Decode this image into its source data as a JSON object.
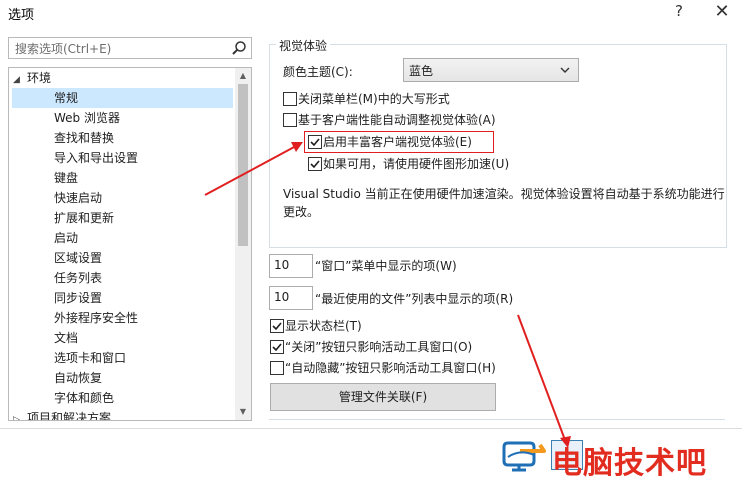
{
  "window": {
    "title": "选项",
    "help_glyph": "?",
    "close_glyph": "✕"
  },
  "search": {
    "placeholder": "搜索选项(Ctrl+E)"
  },
  "tree": {
    "parent_label": "环境",
    "items": [
      "常规",
      "Web 浏览器",
      "查找和替换",
      "导入和导出设置",
      "键盘",
      "快速启动",
      "扩展和更新",
      "启动",
      "区域设置",
      "任务列表",
      "同步设置",
      "外接程序安全性",
      "文档",
      "选项卡和窗口",
      "自动恢复",
      "字体和颜色"
    ],
    "next_root_label": "项目和解决方案",
    "selected_index": 0
  },
  "visual": {
    "group_title": "视觉体验",
    "theme_label": "颜色主题(C):",
    "theme_value": "蓝色",
    "options": [
      {
        "label": "关闭菜单栏(M)中的大写形式",
        "checked": false
      },
      {
        "label": "基于客户端性能自动调整视觉体验(A)",
        "checked": false
      },
      {
        "label": "启用丰富客户端视觉体验(E)",
        "checked": true
      },
      {
        "label": "如果可用，请使用硬件图形加速(U)",
        "checked": true
      }
    ],
    "info_line1": "Visual Studio 当前正在使用硬件加速渲染。视觉体验设置将自动基于系统功能进行",
    "info_line2": "更改。"
  },
  "window_menu": {
    "count": "10",
    "label": "“窗口”菜单中显示的项(W)"
  },
  "recent_files": {
    "count": "10",
    "label": "“最近使用的文件”列表中显示的项(R)"
  },
  "checks": [
    {
      "label": "显示状态栏(T)",
      "checked": true
    },
    {
      "label": "“关闭”按钮只影响活动工具窗口(O)",
      "checked": true
    },
    {
      "label": "“自动隐藏”按钮只影响活动工具窗口(H)",
      "checked": false
    }
  ],
  "manage_button": "管理文件关联(F)",
  "watermark": {
    "text": "电脑技术吧"
  },
  "colors": {
    "selection": "#cce8ff",
    "annotation_red": "#e02020",
    "watermark_red": "#e22c1f"
  }
}
